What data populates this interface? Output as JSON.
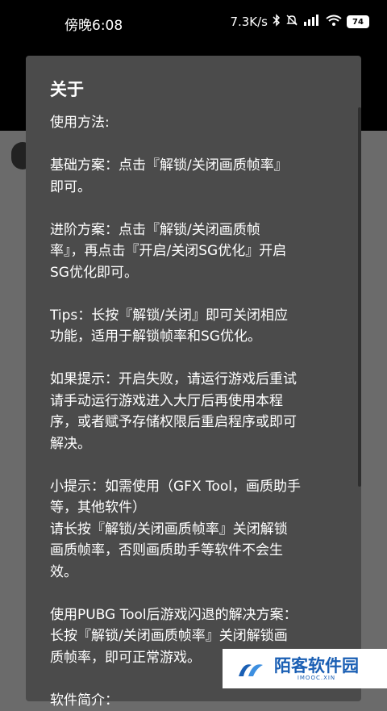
{
  "status_bar": {
    "time": "傍晚6:08",
    "net_speed": "7.3K/s",
    "battery": "74"
  },
  "dialog": {
    "title": "关于",
    "body": "使用方法:\n\n基础方案：点击『解锁/关闭画质帧率』\n即可。\n\n进阶方案：点击『解锁/关闭画质帧\n率』，再点击『开启/关闭SG优化』开启\nSG优化即可。\n\nTips：长按『解锁/关闭』即可关闭相应\n功能，适用于解锁帧率和SG优化。\n\n如果提示：开启失败，请运行游戏后重试\n请手动运行游戏进入大厅后再使用本程\n序，或者赋予存储权限后重启程序或即可\n解决。\n\n小提示：如需使用（GFX Tool，画质助手\n等，其他软件）\n请长按『解锁/关闭画质帧率』关闭解锁\n画质帧率，否则画质助手等软件不会生\n效。\n\n使用PUBG Tool后游戏闪退的解决方案：\n长按『解锁/关闭画质帧率』关闭解锁画\n质帧率，即可正常游戏。\n\n软件简介："
  },
  "watermark": {
    "text": "陌客软件园",
    "sub": "IMOOC.XIN"
  }
}
